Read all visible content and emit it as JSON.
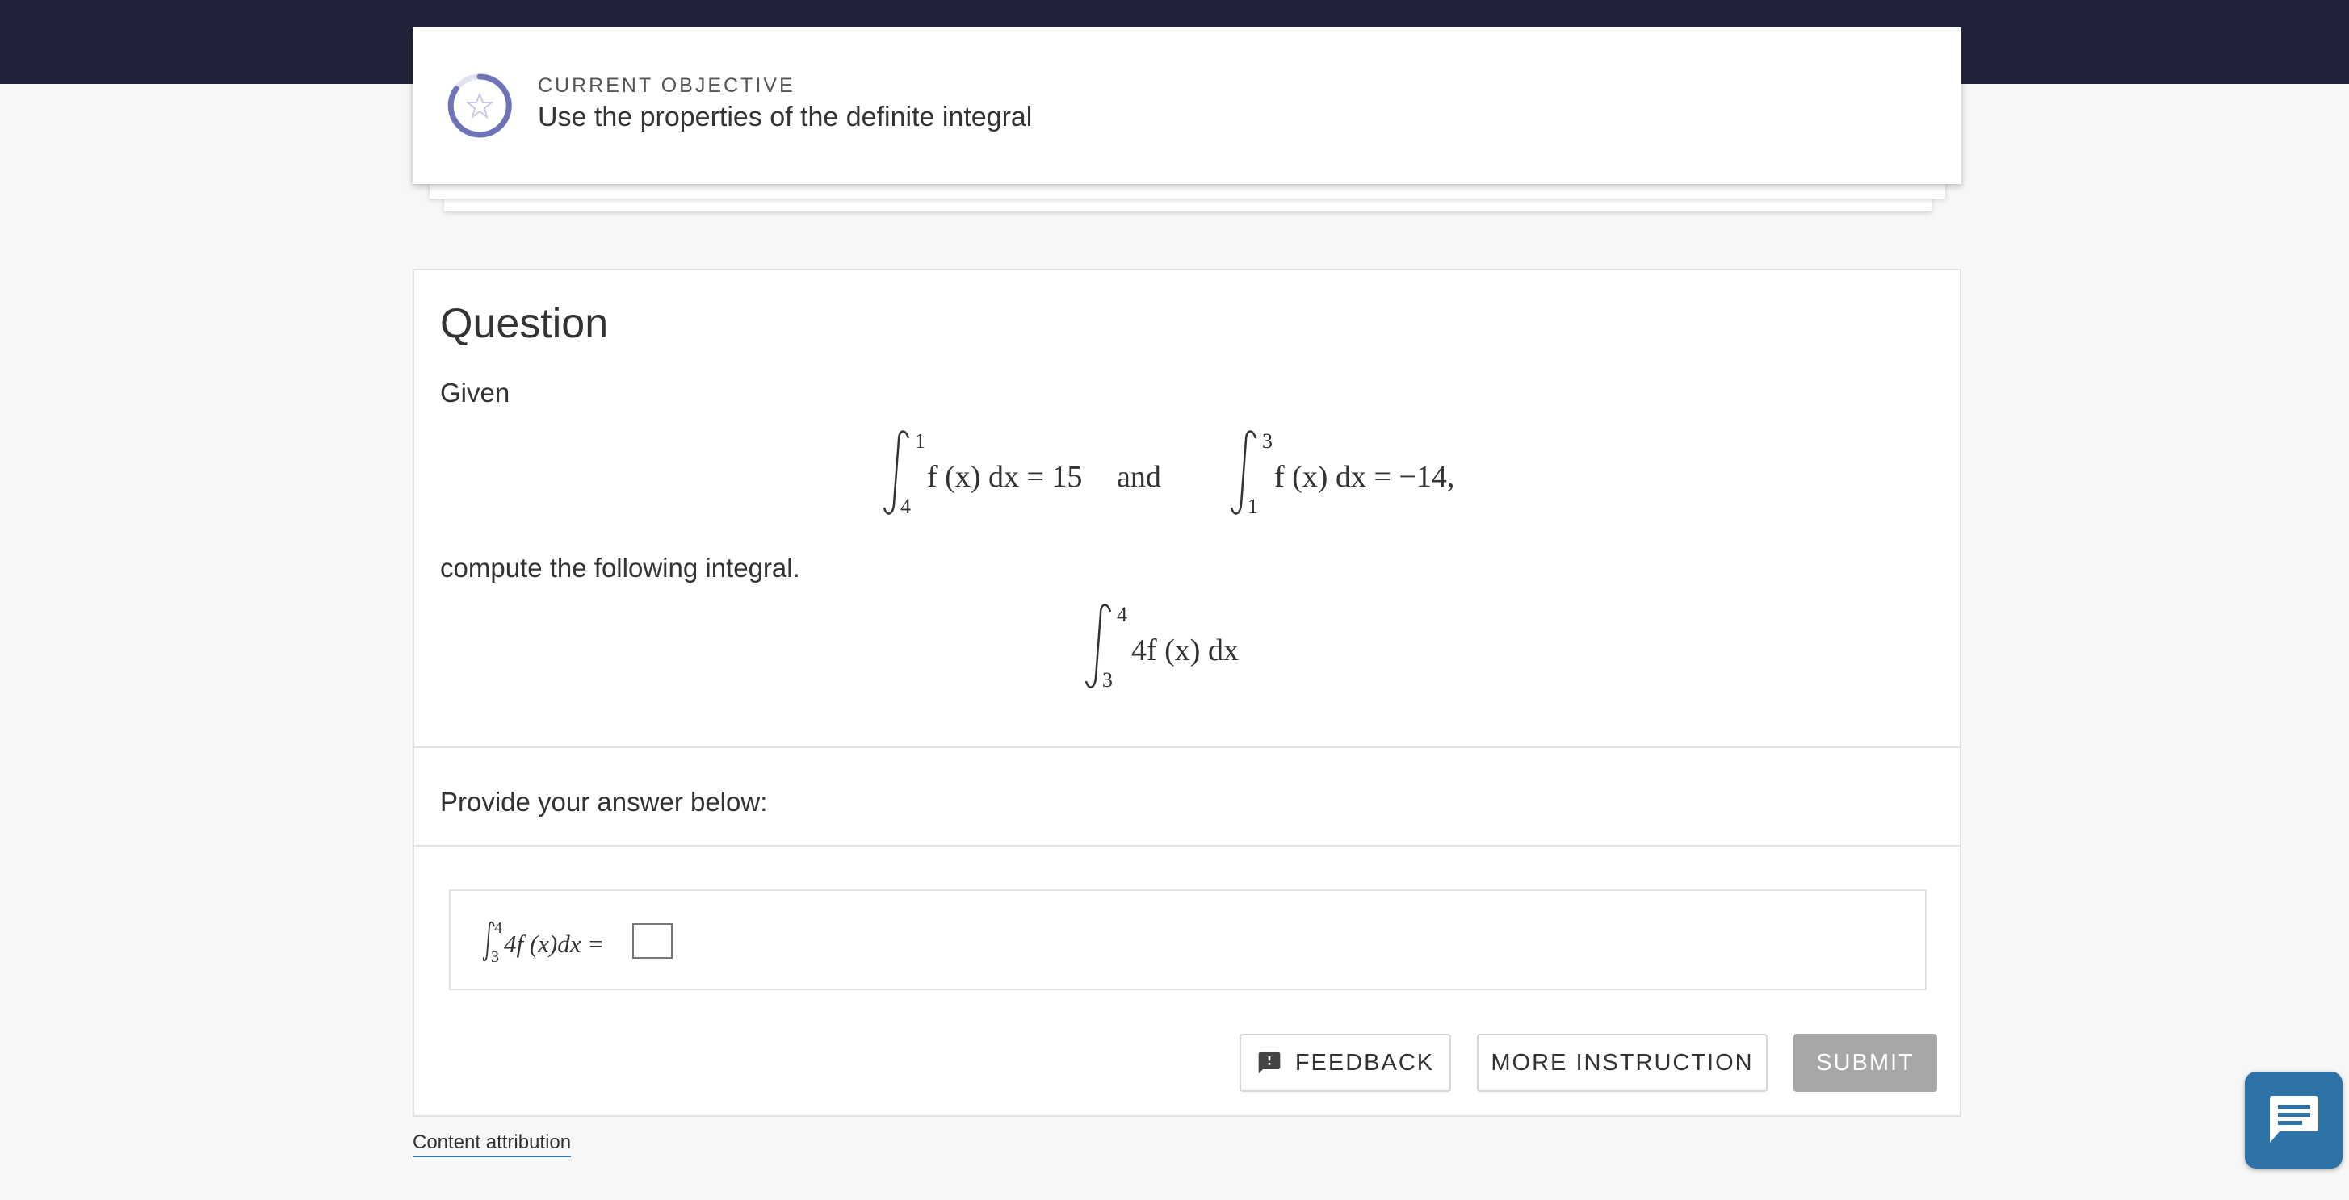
{
  "objective": {
    "label": "CURRENT OBJECTIVE",
    "title": "Use the properties of the definite integral"
  },
  "question": {
    "heading": "Question",
    "given": "Given",
    "equation1": {
      "int1_upper": "1",
      "int1_lower": "4",
      "int1_body": "f (x) dx = 15",
      "connector": "and",
      "int2_upper": "3",
      "int2_lower": "1",
      "int2_body": "f (x) dx = −14,"
    },
    "compute_text": "compute the following integral.",
    "equation2": {
      "upper": "4",
      "lower": "3",
      "body": "4f (x) dx"
    }
  },
  "answer": {
    "prompt": "Provide your answer below:",
    "expr_upper": "4",
    "expr_lower": "3",
    "expr_body": "4f (x)dx ="
  },
  "buttons": {
    "feedback": "FEEDBACK",
    "more_instruction": "MORE INSTRUCTION",
    "submit": "SUBMIT"
  },
  "footer": {
    "attribution": "Content attribution"
  },
  "colors": {
    "topbar": "#21233a",
    "ring": "#6f74b8",
    "chat": "#2e73a7",
    "submit_disabled": "#a7a7a7"
  },
  "icons": {
    "objective": "star-icon",
    "feedback": "feedback-icon",
    "chat": "chat-icon"
  }
}
